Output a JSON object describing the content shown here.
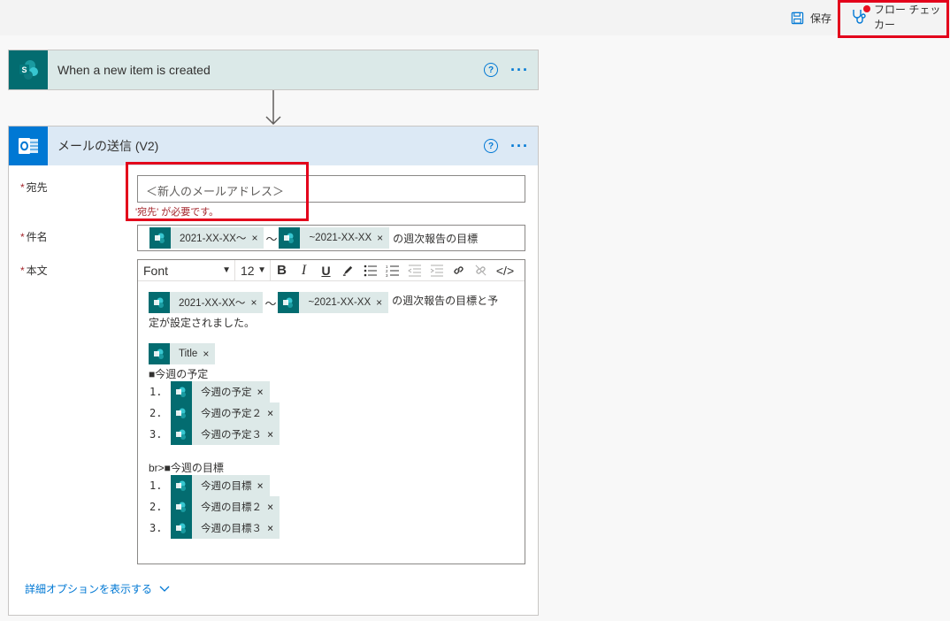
{
  "topbar": {
    "save_label": "保存",
    "checker_label": "フロー チェッカー"
  },
  "trigger": {
    "title": "When a new item is created",
    "help": "?",
    "more": "···"
  },
  "action": {
    "title": "メールの送信 (V2)",
    "help": "?",
    "more": "···",
    "to": {
      "label": "宛先",
      "required_mark": "*",
      "value": "＜新人のメールアドレス＞",
      "error": "'宛先' が必要です。"
    },
    "subject": {
      "label": "件名",
      "required_mark": "*",
      "token1": "2021-XX-XX〜",
      "sep": "〜",
      "token2": "~2021-XX-XX",
      "suffix": "の週次報告の目標",
      "remove": "×"
    },
    "body": {
      "label": "本文",
      "required_mark": "*",
      "font": "Font",
      "size": "12",
      "bold": "B",
      "italic": "I",
      "underline": "U",
      "code": "</>",
      "dropdown_caret": "▼",
      "remove": "×",
      "line1_token1": "2021-XX-XX〜",
      "line1_sep": "〜",
      "line1_token2": "~2021-XX-XX",
      "line1_suffix": "の週次報告の目標と予",
      "line2": "定が設定されました。",
      "title_token": "Title",
      "plan_heading": "■今週の予定",
      "plan_items": [
        "今週の予定",
        "今週の予定２",
        "今週の予定３"
      ],
      "goal_heading": "br>■今週の目標",
      "goal_items": [
        "今週の目標",
        "今週の目標２",
        "今週の目標３"
      ],
      "list_numbers": [
        "1.",
        "2.",
        "3."
      ]
    },
    "advanced_label": "詳細オプションを表示する"
  },
  "colors": {
    "sharepoint": "#036c70",
    "outlook": "#0078d4",
    "highlight": "#e3001b",
    "trigger_header": "#dbe9e8",
    "action_header": "#dce9f5"
  }
}
